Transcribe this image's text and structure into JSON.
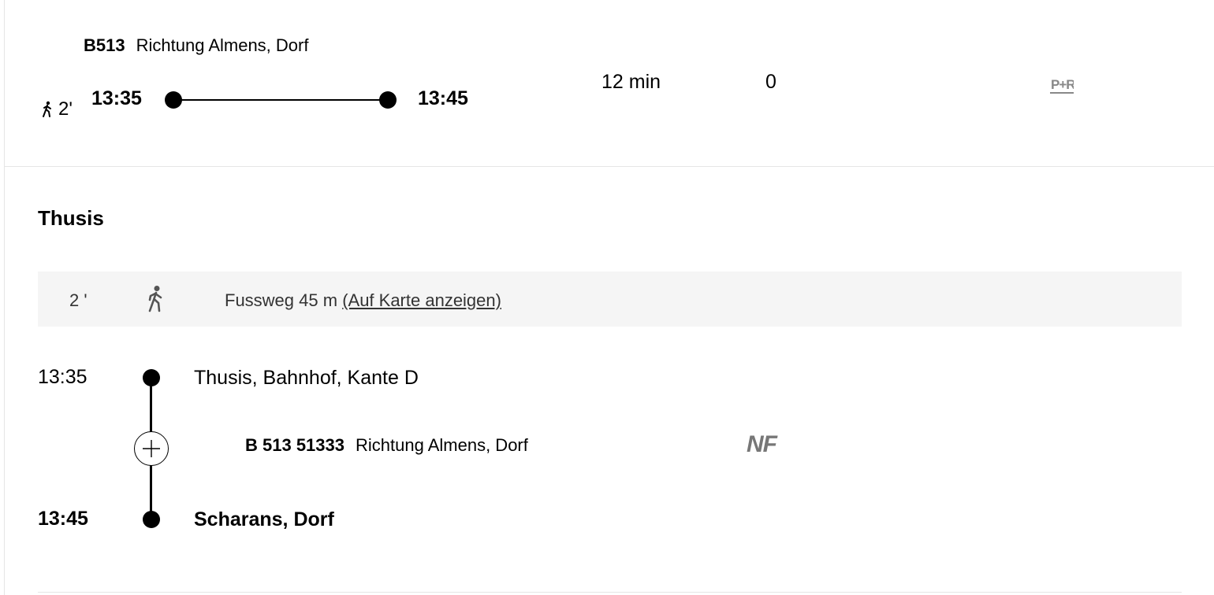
{
  "summary": {
    "line_id": "B513",
    "direction": "Richtung Almens, Dorf",
    "walk_minutes": "2'",
    "departure_time": "13:35",
    "arrival_time": "13:45",
    "duration": "12 min",
    "changes": "0",
    "facility_icon": "park-and-ride-icon",
    "facility_label": "P+R"
  },
  "details": {
    "station_title": "Thusis",
    "walk": {
      "minutes": "2 '",
      "icon": "pedestrian-icon",
      "text": "Fussweg 45 m",
      "link": "(Auf Karte anzeigen)"
    },
    "departure": {
      "time": "13:35",
      "stop": "Thusis, Bahnhof, Kante D"
    },
    "journey": {
      "line": "B 513 51333",
      "direction": "Richtung Almens, Dorf",
      "badge": "NF",
      "expand_icon": "plus-icon"
    },
    "arrival": {
      "time": "13:45",
      "stop": "Scharans, Dorf"
    }
  }
}
